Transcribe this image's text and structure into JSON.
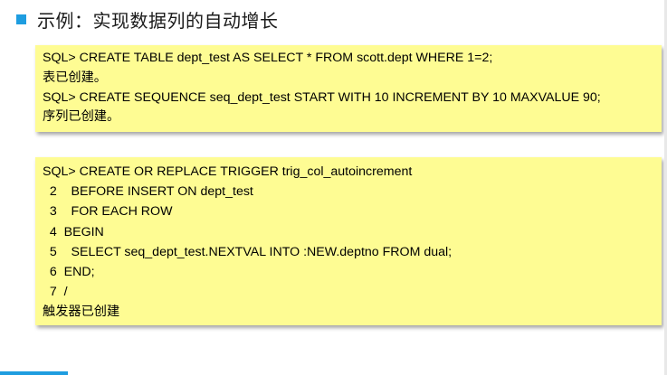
{
  "colors": {
    "accent": "#1e9de0",
    "box_fill": "#fefc93"
  },
  "title": {
    "icon": "square-bullet-icon",
    "text": "示例：实现数据列的自动增长"
  },
  "code_box_1": {
    "lines": [
      "SQL> CREATE TABLE dept_test AS SELECT * FROM scott.dept WHERE 1=2;",
      "表已创建。",
      "SQL> CREATE SEQUENCE seq_dept_test START WITH 10 INCREMENT BY 10 MAXVALUE 90;",
      "序列已创建。"
    ]
  },
  "code_box_2": {
    "lines": [
      "SQL> CREATE OR REPLACE TRIGGER trig_col_autoincrement",
      "  2    BEFORE INSERT ON dept_test",
      "  3    FOR EACH ROW",
      "  4  BEGIN",
      "  5    SELECT seq_dept_test.NEXTVAL INTO :NEW.deptno FROM dual;",
      "  6  END;",
      "  7  /",
      "触发器已创建"
    ]
  }
}
